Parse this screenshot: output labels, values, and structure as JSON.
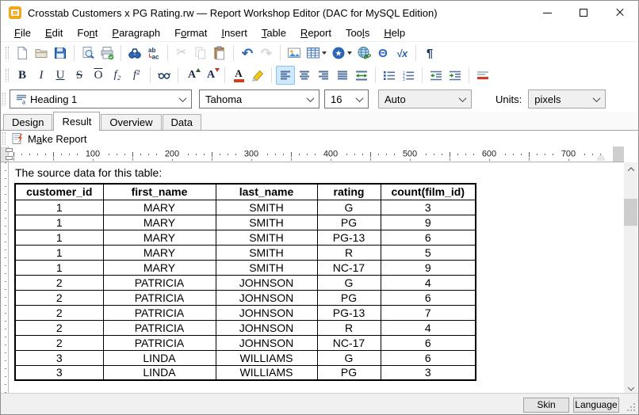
{
  "window": {
    "title": "Crosstab Customers x PG Rating.rw — Report Workshop Editor (DAC for MySQL Edition)"
  },
  "menu": {
    "items": [
      {
        "pre": "",
        "key": "F",
        "post": "ile"
      },
      {
        "pre": "",
        "key": "E",
        "post": "dit"
      },
      {
        "pre": "Fo",
        "key": "n",
        "post": "t"
      },
      {
        "pre": "",
        "key": "P",
        "post": "aragraph"
      },
      {
        "pre": "F",
        "key": "o",
        "post": "rmat"
      },
      {
        "pre": "",
        "key": "I",
        "post": "nsert"
      },
      {
        "pre": "",
        "key": "T",
        "post": "able"
      },
      {
        "pre": "",
        "key": "R",
        "post": "eport"
      },
      {
        "pre": "Too",
        "key": "l",
        "post": "s"
      },
      {
        "pre": "",
        "key": "H",
        "post": "elp"
      }
    ]
  },
  "toolbar_main_icons": [
    "new-document",
    "open-folder",
    "save",
    "print-preview",
    "print",
    "find",
    "replace",
    "cut",
    "copy",
    "paste",
    "undo",
    "redo",
    "insert-image",
    "insert-table",
    "insert-symbol",
    "insert-hyperlink",
    "insert-greek-letter",
    "insert-formula",
    "formatting-marks"
  ],
  "toolbar_format_icons": [
    "bold",
    "italic",
    "underline",
    "strikethrough",
    "overline",
    "subscript",
    "superscript",
    "glasses",
    "grow-font",
    "shrink-font",
    "font-color",
    "highlight",
    "align-left",
    "align-center",
    "align-right",
    "justify",
    "fit-width",
    "bullet-list",
    "numbered-list",
    "decrease-indent",
    "increase-indent",
    "horizontal-rule"
  ],
  "glyphs": {
    "bold": "B",
    "italic": "I",
    "underline": "U",
    "strikethrough": "S",
    "overline": "O",
    "subscript": "f₂",
    "superscript": "f²",
    "grow_font": "A",
    "shrink_font": "A",
    "font_color": "A",
    "undo": "↶",
    "redo": "↷",
    "cut": "✂",
    "theta": "Θ",
    "sqrt": "√x",
    "pilcrow": "¶"
  },
  "format_bar": {
    "style": "Heading 1",
    "font": "Tahoma",
    "size": "16",
    "color": "Auto",
    "units_label": "Units:",
    "units": "pixels"
  },
  "tabs": {
    "active": "Result",
    "items": [
      {
        "label": "Design"
      },
      {
        "label": "Result"
      },
      {
        "label": "Overview"
      },
      {
        "label": "Data"
      }
    ]
  },
  "make_report": {
    "pre": "M",
    "key": "a",
    "post": "ke Report"
  },
  "ruler": {
    "labels": [
      "100",
      "200",
      "300",
      "400",
      "500",
      "600",
      "700"
    ]
  },
  "document": {
    "caption": "The source data for this table:",
    "table": {
      "headers": [
        "customer_id",
        "first_name",
        "last_name",
        "rating",
        "count(film_id)"
      ],
      "rows": [
        [
          "1",
          "MARY",
          "SMITH",
          "G",
          "3"
        ],
        [
          "1",
          "MARY",
          "SMITH",
          "PG",
          "9"
        ],
        [
          "1",
          "MARY",
          "SMITH",
          "PG-13",
          "6"
        ],
        [
          "1",
          "MARY",
          "SMITH",
          "R",
          "5"
        ],
        [
          "1",
          "MARY",
          "SMITH",
          "NC-17",
          "9"
        ],
        [
          "2",
          "PATRICIA",
          "JOHNSON",
          "G",
          "4"
        ],
        [
          "2",
          "PATRICIA",
          "JOHNSON",
          "PG",
          "6"
        ],
        [
          "2",
          "PATRICIA",
          "JOHNSON",
          "PG-13",
          "7"
        ],
        [
          "2",
          "PATRICIA",
          "JOHNSON",
          "R",
          "4"
        ],
        [
          "2",
          "PATRICIA",
          "JOHNSON",
          "NC-17",
          "6"
        ],
        [
          "3",
          "LINDA",
          "WILLIAMS",
          "G",
          "6"
        ],
        [
          "3",
          "LINDA",
          "WILLIAMS",
          "PG",
          "3"
        ]
      ]
    }
  },
  "status_bar": {
    "skin": "Skin",
    "language": "Language"
  },
  "colors": {
    "accent_blue": "#2f66b3",
    "toolbar_letter": "#1a2a4a",
    "align_bars": "#53719b",
    "active_tool_bg": "#cfe8fc",
    "active_tool_border": "#88c3f0",
    "hr_red": "#cc4125",
    "app_icon_orange": "#f2a81d",
    "scroll_thumb": "#cdcdcd",
    "status_bg": "#f0f0f0"
  }
}
